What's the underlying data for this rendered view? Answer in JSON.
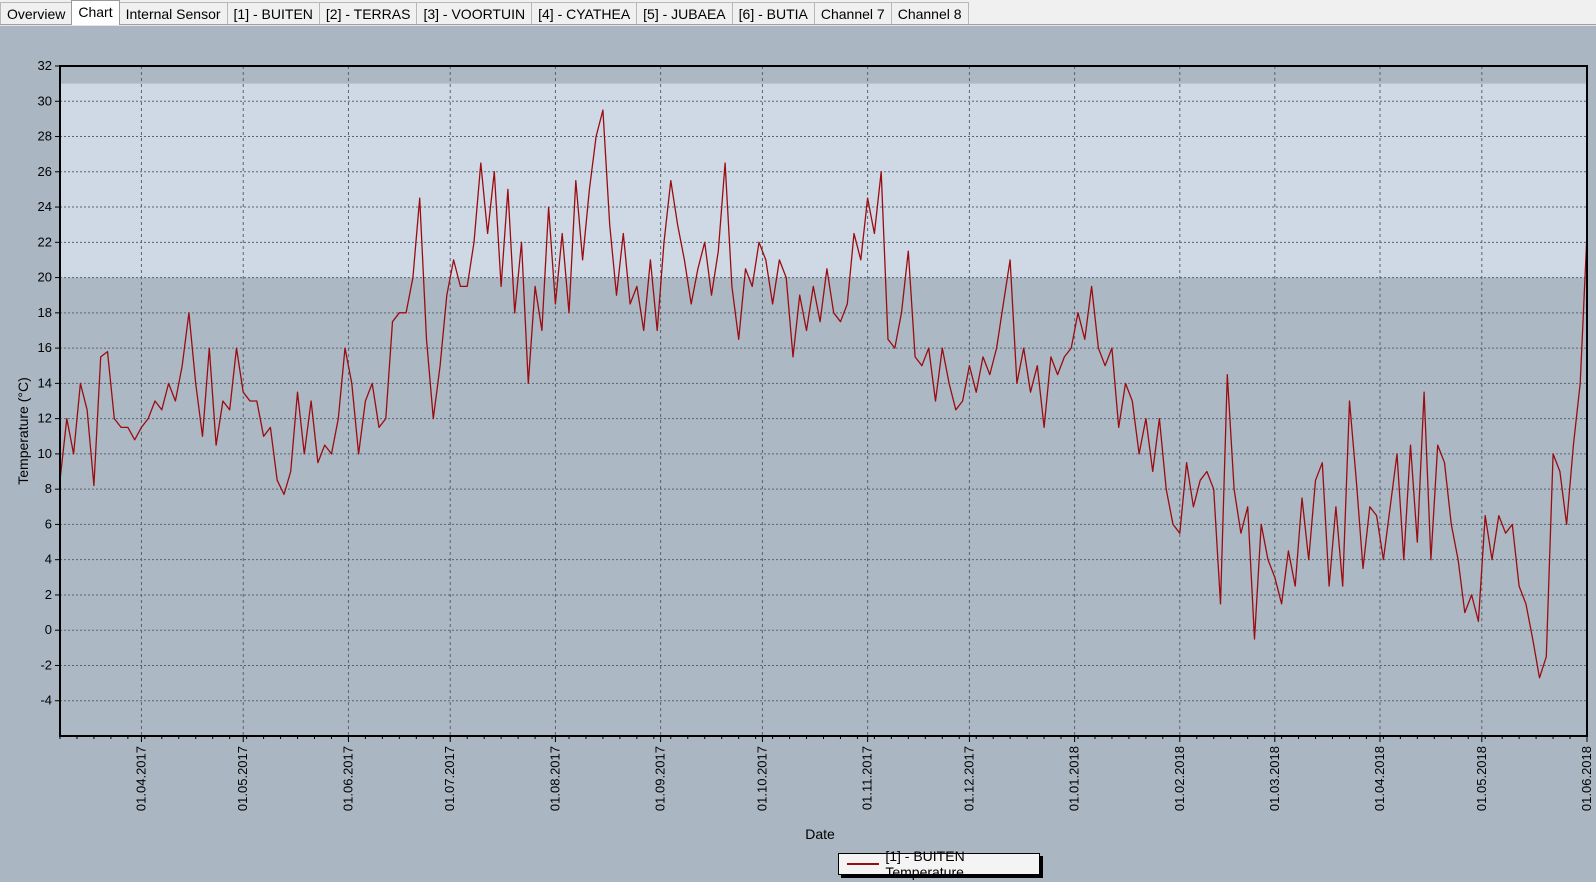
{
  "tabs": [
    {
      "label": "Overview",
      "active": false
    },
    {
      "label": "Chart",
      "active": true
    },
    {
      "label": "Internal Sensor",
      "active": false
    },
    {
      "label": "[1] - BUITEN",
      "active": false
    },
    {
      "label": "[2] - TERRAS",
      "active": false
    },
    {
      "label": "[3] - VOORTUIN",
      "active": false
    },
    {
      "label": "[4] - CYATHEA",
      "active": false
    },
    {
      "label": "[5] - JUBAEA",
      "active": false
    },
    {
      "label": "[6] - BUTIA",
      "active": false
    },
    {
      "label": "Channel 7",
      "active": false
    },
    {
      "label": "Channel 8",
      "active": false
    }
  ],
  "colors": {
    "series": "#9b0c10",
    "plot_background": "#acb8c4",
    "highlight_band": "#ced9e5"
  },
  "legend": {
    "entries": [
      "[1] - BUITEN Temperature"
    ],
    "placement": "bottom-center"
  },
  "chart_data": {
    "type": "line",
    "xlabel": "Date",
    "ylabel": "Temperature (°C)",
    "ylim": [
      -6,
      32
    ],
    "yticks": [
      -4,
      -2,
      0,
      2,
      4,
      6,
      8,
      10,
      12,
      14,
      16,
      18,
      20,
      22,
      24,
      26,
      28,
      30,
      32
    ],
    "xlim": [
      "2017-03-08",
      "2018-06-01"
    ],
    "xticks": [
      "01.04.2017",
      "01.05.2017",
      "01.06.2017",
      "01.07.2017",
      "01.08.2017",
      "01.09.2017",
      "01.10.2017",
      "01.11.2017",
      "01.12.2017",
      "01.01.2018",
      "01.02.2018",
      "01.03.2018",
      "01.04.2018",
      "01.05.2018",
      "01.06.2018"
    ],
    "highlight_band": [
      20,
      31
    ],
    "grid": true,
    "series": [
      {
        "name": "[1] - BUITEN Temperature",
        "points": [
          [
            "2017-03-08",
            8.5
          ],
          [
            "2017-03-10",
            12
          ],
          [
            "2017-03-12",
            10
          ],
          [
            "2017-03-14",
            14
          ],
          [
            "2017-03-16",
            12.5
          ],
          [
            "2017-03-18",
            8.2
          ],
          [
            "2017-03-20",
            15.5
          ],
          [
            "2017-03-22",
            15.8
          ],
          [
            "2017-03-24",
            12
          ],
          [
            "2017-03-26",
            11.5
          ],
          [
            "2017-03-28",
            11.5
          ],
          [
            "2017-03-30",
            10.8
          ],
          [
            "2017-04-01",
            11.5
          ],
          [
            "2017-04-03",
            12
          ],
          [
            "2017-04-05",
            13
          ],
          [
            "2017-04-07",
            12.5
          ],
          [
            "2017-04-09",
            14
          ],
          [
            "2017-04-11",
            13
          ],
          [
            "2017-04-13",
            15
          ],
          [
            "2017-04-15",
            18
          ],
          [
            "2017-04-17",
            14
          ],
          [
            "2017-04-19",
            11
          ],
          [
            "2017-04-21",
            16
          ],
          [
            "2017-04-23",
            10.5
          ],
          [
            "2017-04-25",
            13
          ],
          [
            "2017-04-27",
            12.5
          ],
          [
            "2017-04-29",
            16
          ],
          [
            "2017-05-01",
            13.5
          ],
          [
            "2017-05-03",
            13
          ],
          [
            "2017-05-05",
            13
          ],
          [
            "2017-05-07",
            11
          ],
          [
            "2017-05-09",
            11.5
          ],
          [
            "2017-05-11",
            8.5
          ],
          [
            "2017-05-13",
            7.7
          ],
          [
            "2017-05-15",
            9
          ],
          [
            "2017-05-17",
            13.5
          ],
          [
            "2017-05-19",
            10
          ],
          [
            "2017-05-21",
            13
          ],
          [
            "2017-05-23",
            9.5
          ],
          [
            "2017-05-25",
            10.5
          ],
          [
            "2017-05-27",
            10
          ],
          [
            "2017-05-29",
            12
          ],
          [
            "2017-05-31",
            16
          ],
          [
            "2017-06-02",
            14
          ],
          [
            "2017-06-04",
            10
          ],
          [
            "2017-06-06",
            13
          ],
          [
            "2017-06-08",
            14
          ],
          [
            "2017-06-10",
            11.5
          ],
          [
            "2017-06-12",
            12
          ],
          [
            "2017-06-14",
            17.5
          ],
          [
            "2017-06-16",
            18
          ],
          [
            "2017-06-18",
            18
          ],
          [
            "2017-06-20",
            20
          ],
          [
            "2017-06-22",
            24.5
          ],
          [
            "2017-06-24",
            16.5
          ],
          [
            "2017-06-26",
            12
          ],
          [
            "2017-06-28",
            15
          ],
          [
            "2017-06-30",
            19
          ],
          [
            "2017-07-02",
            21
          ],
          [
            "2017-07-04",
            19.5
          ],
          [
            "2017-07-06",
            19.5
          ],
          [
            "2017-07-08",
            22
          ],
          [
            "2017-07-10",
            26.5
          ],
          [
            "2017-07-12",
            22.5
          ],
          [
            "2017-07-14",
            26
          ],
          [
            "2017-07-16",
            19.5
          ],
          [
            "2017-07-18",
            25
          ],
          [
            "2017-07-20",
            18
          ],
          [
            "2017-07-22",
            22
          ],
          [
            "2017-07-24",
            14
          ],
          [
            "2017-07-26",
            19.5
          ],
          [
            "2017-07-28",
            17
          ],
          [
            "2017-07-30",
            24
          ],
          [
            "2017-08-01",
            18.5
          ],
          [
            "2017-08-03",
            22.5
          ],
          [
            "2017-08-05",
            18
          ],
          [
            "2017-08-07",
            25.5
          ],
          [
            "2017-08-09",
            21
          ],
          [
            "2017-08-11",
            25
          ],
          [
            "2017-08-13",
            28
          ],
          [
            "2017-08-15",
            29.5
          ],
          [
            "2017-08-17",
            23
          ],
          [
            "2017-08-19",
            19
          ],
          [
            "2017-08-21",
            22.5
          ],
          [
            "2017-08-23",
            18.5
          ],
          [
            "2017-08-25",
            19.5
          ],
          [
            "2017-08-27",
            17
          ],
          [
            "2017-08-29",
            21
          ],
          [
            "2017-08-31",
            17
          ],
          [
            "2017-09-02",
            22
          ],
          [
            "2017-09-04",
            25.5
          ],
          [
            "2017-09-06",
            23
          ],
          [
            "2017-09-08",
            21
          ],
          [
            "2017-09-10",
            18.5
          ],
          [
            "2017-09-12",
            20.5
          ],
          [
            "2017-09-14",
            22
          ],
          [
            "2017-09-16",
            19
          ],
          [
            "2017-09-18",
            21.5
          ],
          [
            "2017-09-20",
            26.5
          ],
          [
            "2017-09-22",
            19.5
          ],
          [
            "2017-09-24",
            16.5
          ],
          [
            "2017-09-26",
            20.5
          ],
          [
            "2017-09-28",
            19.5
          ],
          [
            "2017-09-30",
            22
          ],
          [
            "2017-10-02",
            21
          ],
          [
            "2017-10-04",
            18.5
          ],
          [
            "2017-10-06",
            21
          ],
          [
            "2017-10-08",
            20
          ],
          [
            "2017-10-10",
            15.5
          ],
          [
            "2017-10-12",
            19
          ],
          [
            "2017-10-14",
            17
          ],
          [
            "2017-10-16",
            19.5
          ],
          [
            "2017-10-18",
            17.5
          ],
          [
            "2017-10-20",
            20.5
          ],
          [
            "2017-10-22",
            18
          ],
          [
            "2017-10-24",
            17.5
          ],
          [
            "2017-10-26",
            18.5
          ],
          [
            "2017-10-28",
            22.5
          ],
          [
            "2017-10-30",
            21
          ],
          [
            "2017-11-01",
            24.5
          ],
          [
            "2017-11-03",
            22.5
          ],
          [
            "2017-11-05",
            26
          ],
          [
            "2017-11-07",
            16.5
          ],
          [
            "2017-11-09",
            16
          ],
          [
            "2017-11-11",
            18
          ],
          [
            "2017-11-13",
            21.5
          ],
          [
            "2017-11-15",
            15.5
          ],
          [
            "2017-11-17",
            15
          ],
          [
            "2017-11-19",
            16
          ],
          [
            "2017-11-21",
            13
          ],
          [
            "2017-11-23",
            16
          ],
          [
            "2017-11-25",
            14
          ],
          [
            "2017-11-27",
            12.5
          ],
          [
            "2017-11-29",
            13
          ],
          [
            "2017-12-01",
            15
          ],
          [
            "2017-12-03",
            13.5
          ],
          [
            "2017-12-05",
            15.5
          ],
          [
            "2017-12-07",
            14.5
          ],
          [
            "2017-12-09",
            16
          ],
          [
            "2017-12-11",
            18.5
          ],
          [
            "2017-12-13",
            21
          ],
          [
            "2017-12-15",
            14
          ],
          [
            "2017-12-17",
            16
          ],
          [
            "2017-12-19",
            13.5
          ],
          [
            "2017-12-21",
            15
          ],
          [
            "2017-12-23",
            11.5
          ],
          [
            "2017-12-25",
            15.5
          ],
          [
            "2017-12-27",
            14.5
          ],
          [
            "2017-12-29",
            15.5
          ],
          [
            "2017-12-31",
            16
          ],
          [
            "2018-01-02",
            18
          ],
          [
            "2018-01-04",
            16.5
          ],
          [
            "2018-01-06",
            19.5
          ],
          [
            "2018-01-08",
            16
          ],
          [
            "2018-01-10",
            15
          ],
          [
            "2018-01-12",
            16
          ],
          [
            "2018-01-14",
            11.5
          ],
          [
            "2018-01-16",
            14
          ],
          [
            "2018-01-18",
            13
          ],
          [
            "2018-01-20",
            10
          ],
          [
            "2018-01-22",
            12
          ],
          [
            "2018-01-24",
            9
          ],
          [
            "2018-01-26",
            12
          ],
          [
            "2018-01-28",
            8
          ],
          [
            "2018-01-30",
            6
          ],
          [
            "2018-02-01",
            5.5
          ],
          [
            "2018-02-03",
            9.5
          ],
          [
            "2018-02-05",
            7
          ],
          [
            "2018-02-07",
            8.5
          ],
          [
            "2018-02-09",
            9
          ],
          [
            "2018-02-11",
            8
          ],
          [
            "2018-02-13",
            1.5
          ],
          [
            "2018-02-15",
            14.5
          ],
          [
            "2018-02-17",
            8
          ],
          [
            "2018-02-19",
            5.5
          ],
          [
            "2018-02-21",
            7
          ],
          [
            "2018-02-23",
            -0.5
          ],
          [
            "2018-02-25",
            6
          ],
          [
            "2018-02-27",
            4
          ],
          [
            "2018-03-01",
            3
          ],
          [
            "2018-03-03",
            1.5
          ],
          [
            "2018-03-05",
            4.5
          ],
          [
            "2018-03-07",
            2.5
          ],
          [
            "2018-03-09",
            7.5
          ],
          [
            "2018-03-11",
            4
          ],
          [
            "2018-03-13",
            8.5
          ],
          [
            "2018-03-15",
            9.5
          ],
          [
            "2018-03-17",
            2.5
          ],
          [
            "2018-03-19",
            7
          ],
          [
            "2018-03-21",
            2.5
          ],
          [
            "2018-03-23",
            13
          ],
          [
            "2018-03-25",
            8.5
          ],
          [
            "2018-03-27",
            3.5
          ],
          [
            "2018-03-29",
            7
          ],
          [
            "2018-03-31",
            6.5
          ],
          [
            "2018-04-02",
            4
          ],
          [
            "2018-04-04",
            7
          ],
          [
            "2018-04-06",
            10
          ],
          [
            "2018-04-08",
            4
          ],
          [
            "2018-04-10",
            10.5
          ],
          [
            "2018-04-12",
            5
          ],
          [
            "2018-04-14",
            13.5
          ],
          [
            "2018-04-16",
            4
          ],
          [
            "2018-04-18",
            10.5
          ],
          [
            "2018-04-20",
            9.5
          ],
          [
            "2018-04-22",
            6
          ],
          [
            "2018-04-24",
            4
          ],
          [
            "2018-04-26",
            1
          ],
          [
            "2018-04-28",
            2
          ],
          [
            "2018-04-30",
            0.5
          ],
          [
            "2018-05-02",
            6.5
          ],
          [
            "2018-05-04",
            4
          ],
          [
            "2018-05-06",
            6.5
          ],
          [
            "2018-05-08",
            5.5
          ],
          [
            "2018-05-10",
            6
          ],
          [
            "2018-05-12",
            2.5
          ],
          [
            "2018-05-14",
            1.5
          ],
          [
            "2018-05-16",
            -0.5
          ],
          [
            "2018-05-18",
            -2.7
          ],
          [
            "2018-05-20",
            -1.5
          ],
          [
            "2018-05-22",
            10
          ],
          [
            "2018-05-24",
            9
          ],
          [
            "2018-05-26",
            6
          ],
          [
            "2018-05-28",
            10.5
          ],
          [
            "2018-05-30",
            14
          ],
          [
            "2018-06-01",
            22.5
          ]
        ]
      }
    ]
  }
}
